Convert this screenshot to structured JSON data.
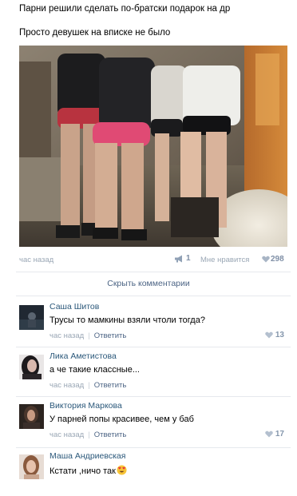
{
  "post": {
    "line1": "Парни решили сделать по-братски подарок на др",
    "line2": "Просто девушек на вписке не было",
    "time": "час назад",
    "share_count": "1",
    "like_label": "Мне нравится",
    "like_count": "298"
  },
  "hide_comments_label": "Скрыть комментарии",
  "comments": [
    {
      "author": "Саша Шитов",
      "text": "Трусы то мамкины взяли чтоли тогда?",
      "time": "час назад",
      "reply_label": "Ответить",
      "likes": "13"
    },
    {
      "author": "Лика Аметистова",
      "text": "а че такие классные...",
      "time": "час назад",
      "reply_label": "Ответить",
      "likes": ""
    },
    {
      "author": "Виктория Маркова",
      "text": "У парней попы красивее, чем у баб",
      "time": "час назад",
      "reply_label": "Ответить",
      "likes": "17"
    },
    {
      "author": "Маша Андриевская",
      "text": "Кстати ,ничо так",
      "emoji": "heart-eyes-emoji"
    }
  ],
  "colors": {
    "link_blue": "#2b587a",
    "muted_gray": "#9aa7b5",
    "action_blue": "#4d6585"
  }
}
